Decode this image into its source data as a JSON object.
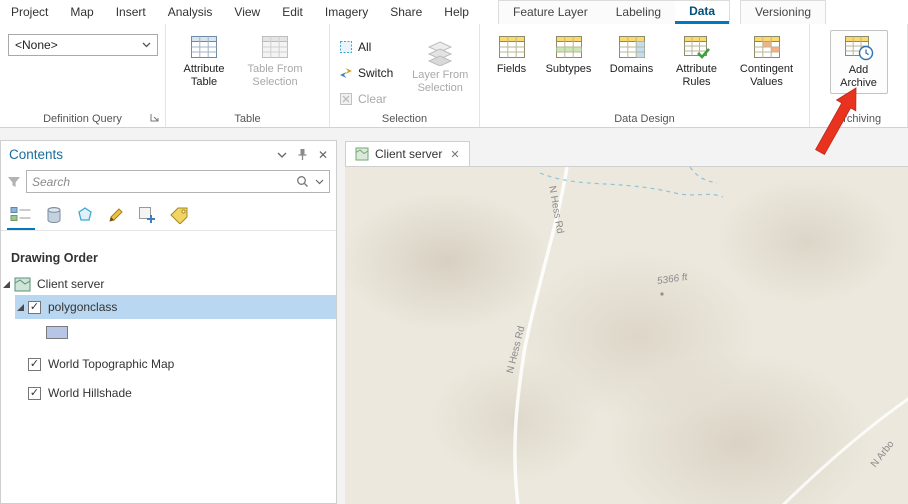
{
  "menubar": {
    "items": [
      "Project",
      "Map",
      "Insert",
      "Analysis",
      "View",
      "Edit",
      "Imagery",
      "Share",
      "Help"
    ]
  },
  "tabs": {
    "context": [
      "Feature Layer",
      "Labeling",
      "Data"
    ],
    "versioning": "Versioning"
  },
  "ribbon": {
    "definition_query": {
      "value": "<None>",
      "group": "Definition Query"
    },
    "table": {
      "group": "Table",
      "attribute_table": "Attribute Table",
      "table_from_selection": "Table From Selection"
    },
    "selection": {
      "group": "Selection",
      "all": "All",
      "switch": "Switch",
      "clear": "Clear",
      "layer_from_selection": "Layer From Selection"
    },
    "data_design": {
      "group": "Data Design",
      "fields": "Fields",
      "subtypes": "Subtypes",
      "domains": "Domains",
      "attribute_rules": "Attribute Rules",
      "contingent_values": "Contingent Values"
    },
    "archiving": {
      "group": "Archiving",
      "add_archive": "Add Archive"
    }
  },
  "contents": {
    "title": "Contents",
    "search_placeholder": "Search",
    "drawing_order": "Drawing Order",
    "layers": [
      {
        "label": "Client server"
      },
      {
        "label": "polygonclass"
      },
      {
        "label": "World Topographic Map"
      },
      {
        "label": "World Hillshade"
      }
    ]
  },
  "map": {
    "tab": "Client server",
    "road_label_1": "N Hess Rd",
    "road_label_2": "N Hess Rd",
    "elevation_label": "5366 ft",
    "road_label_3": "N Arbo"
  },
  "colors": {
    "accent": "#0079c1",
    "selection_highlight": "#b9d7f1",
    "arrow": "#e8331f",
    "contents_title": "#1a6d9e"
  }
}
